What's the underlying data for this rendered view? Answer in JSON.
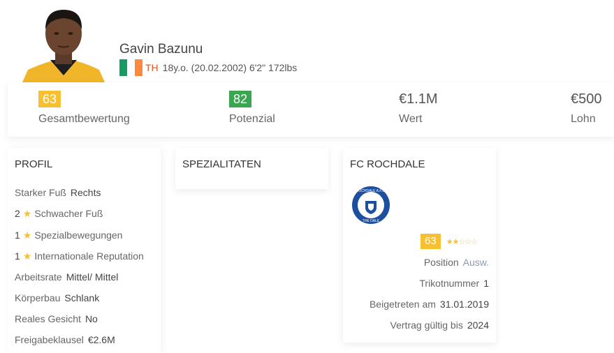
{
  "player": {
    "name": "Gavin Bazunu",
    "position": "TH",
    "meta": "18y.o. (20.02.2002) 6'2\" 172lbs",
    "flag_colors": [
      "#169b62",
      "#ffffff",
      "#ff883e"
    ]
  },
  "stats": [
    {
      "value": "63",
      "label": "Gesamtbewertung",
      "color": "#f7c032"
    },
    {
      "value": "82",
      "label": "Potenzial",
      "color": "#3aa650"
    },
    {
      "value": "€1.1M",
      "label": "Wert"
    },
    {
      "value": "€500",
      "label": "Lohn"
    }
  ],
  "profil": {
    "title": "PROFIL",
    "strong_foot_label": "Starker Fuß",
    "strong_foot_value": "Rechts",
    "weak_foot_num": "2",
    "weak_foot_label": "Schwacher Fuß",
    "skill_moves_num": "1",
    "skill_moves_label": "Spezialbewegungen",
    "intl_rep_num": "1",
    "intl_rep_label": "Internationale Reputation",
    "work_rate_label": "Arbeitsrate",
    "work_rate_value": "Mittel/ Mittel",
    "body_label": "Körperbau",
    "body_value": "Schlank",
    "real_face_label": "Reales Gesicht",
    "real_face_value": "No",
    "release_label": "Freigabeklausel",
    "release_value": "€2.6M"
  },
  "spezialitaten": {
    "title": "SPEZIALITATEN"
  },
  "club": {
    "title": "FC ROCHDALE",
    "crest_text_top": "ROCHDALE A.F.C.",
    "crest_text_bottom": "THE DALE",
    "rating": "63",
    "stars": 2,
    "stars_total": 5,
    "position_label": "Position",
    "position_value": "Ausw.",
    "shirt_label": "Trikotnummer",
    "shirt_value": "1",
    "joined_label": "Beigetreten am",
    "joined_value": "31.01.2019",
    "contract_label": "Vertrag gültig bis",
    "contract_value": "2024"
  },
  "icons": {
    "star": "star-icon",
    "flag": "ireland-flag-icon",
    "crest": "rochdale-crest-icon"
  }
}
